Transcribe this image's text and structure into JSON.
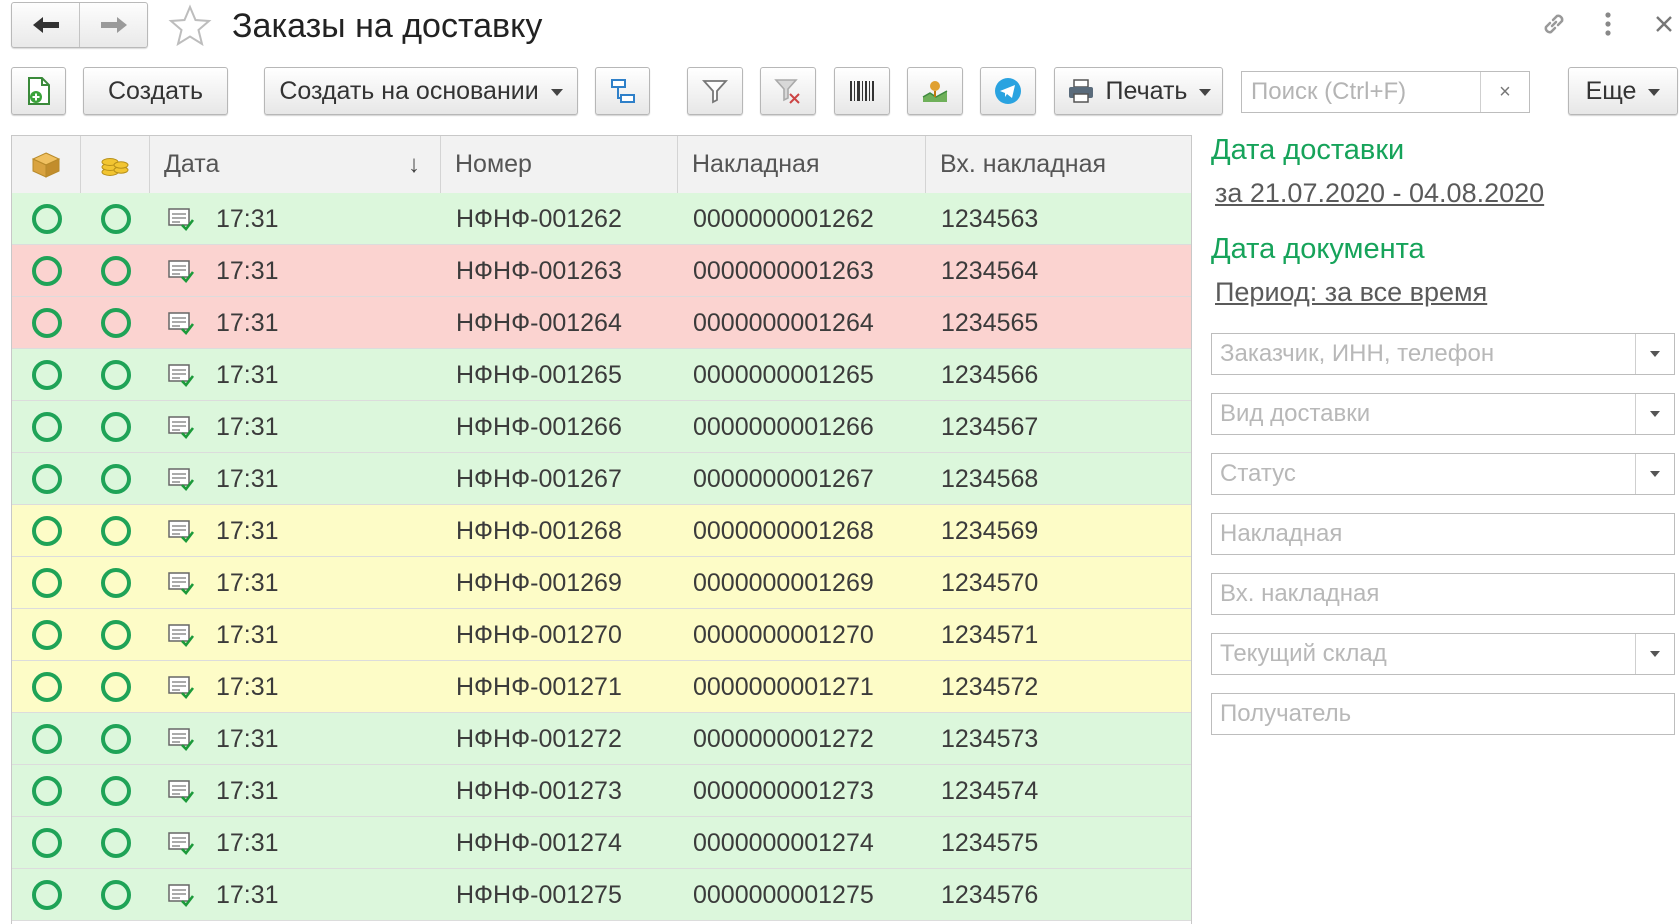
{
  "window": {
    "title": "Заказы на доставку"
  },
  "toolbar": {
    "create_label": "Создать",
    "create_based_label": "Создать на основании",
    "print_label": "Печать",
    "more_label": "Еще",
    "search_placeholder": "Поиск (Ctrl+F)",
    "search_clear": "×"
  },
  "table": {
    "columns": [
      "Дата",
      "Номер",
      "Накладная",
      "Вх. накладная"
    ],
    "sort_indicator": "↓",
    "rows": [
      {
        "time": "17:31",
        "number": "НФНФ-001262",
        "invoice": "0000000001262",
        "in_invoice": "1234563",
        "color": "green"
      },
      {
        "time": "17:31",
        "number": "НФНФ-001263",
        "invoice": "0000000001263",
        "in_invoice": "1234564",
        "color": "red"
      },
      {
        "time": "17:31",
        "number": "НФНФ-001264",
        "invoice": "0000000001264",
        "in_invoice": "1234565",
        "color": "red"
      },
      {
        "time": "17:31",
        "number": "НФНФ-001265",
        "invoice": "0000000001265",
        "in_invoice": "1234566",
        "color": "green"
      },
      {
        "time": "17:31",
        "number": "НФНФ-001266",
        "invoice": "0000000001266",
        "in_invoice": "1234567",
        "color": "green"
      },
      {
        "time": "17:31",
        "number": "НФНФ-001267",
        "invoice": "0000000001267",
        "in_invoice": "1234568",
        "color": "green"
      },
      {
        "time": "17:31",
        "number": "НФНФ-001268",
        "invoice": "0000000001268",
        "in_invoice": "1234569",
        "color": "yellow"
      },
      {
        "time": "17:31",
        "number": "НФНФ-001269",
        "invoice": "0000000001269",
        "in_invoice": "1234570",
        "color": "yellow"
      },
      {
        "time": "17:31",
        "number": "НФНФ-001270",
        "invoice": "0000000001270",
        "in_invoice": "1234571",
        "color": "yellow"
      },
      {
        "time": "17:31",
        "number": "НФНФ-001271",
        "invoice": "0000000001271",
        "in_invoice": "1234572",
        "color": "yellow"
      },
      {
        "time": "17:31",
        "number": "НФНФ-001272",
        "invoice": "0000000001272",
        "in_invoice": "1234573",
        "color": "green"
      },
      {
        "time": "17:31",
        "number": "НФНФ-001273",
        "invoice": "0000000001273",
        "in_invoice": "1234574",
        "color": "green"
      },
      {
        "time": "17:31",
        "number": "НФНФ-001274",
        "invoice": "0000000001274",
        "in_invoice": "1234575",
        "color": "green"
      },
      {
        "time": "17:31",
        "number": "НФНФ-001275",
        "invoice": "0000000001275",
        "in_invoice": "1234576",
        "color": "green"
      }
    ]
  },
  "filters": {
    "delivery_date_label": "Дата доставки",
    "delivery_date_value": "за 21.07.2020 - 04.08.2020",
    "doc_date_label": "Дата документа",
    "doc_date_value": "Период: за все время",
    "customer_placeholder": "Заказчик, ИНН, телефон",
    "delivery_type_placeholder": "Вид доставки",
    "status_placeholder": "Статус",
    "invoice_placeholder": "Накладная",
    "in_invoice_placeholder": "Вх. накладная",
    "warehouse_placeholder": "Текущий склад",
    "recipient_placeholder": "Получатель"
  },
  "colors": {
    "accent_green": "#16a35a",
    "row_green": "#dcf7dc",
    "row_red": "#fbd3d0",
    "row_yellow": "#fdfcc7"
  }
}
